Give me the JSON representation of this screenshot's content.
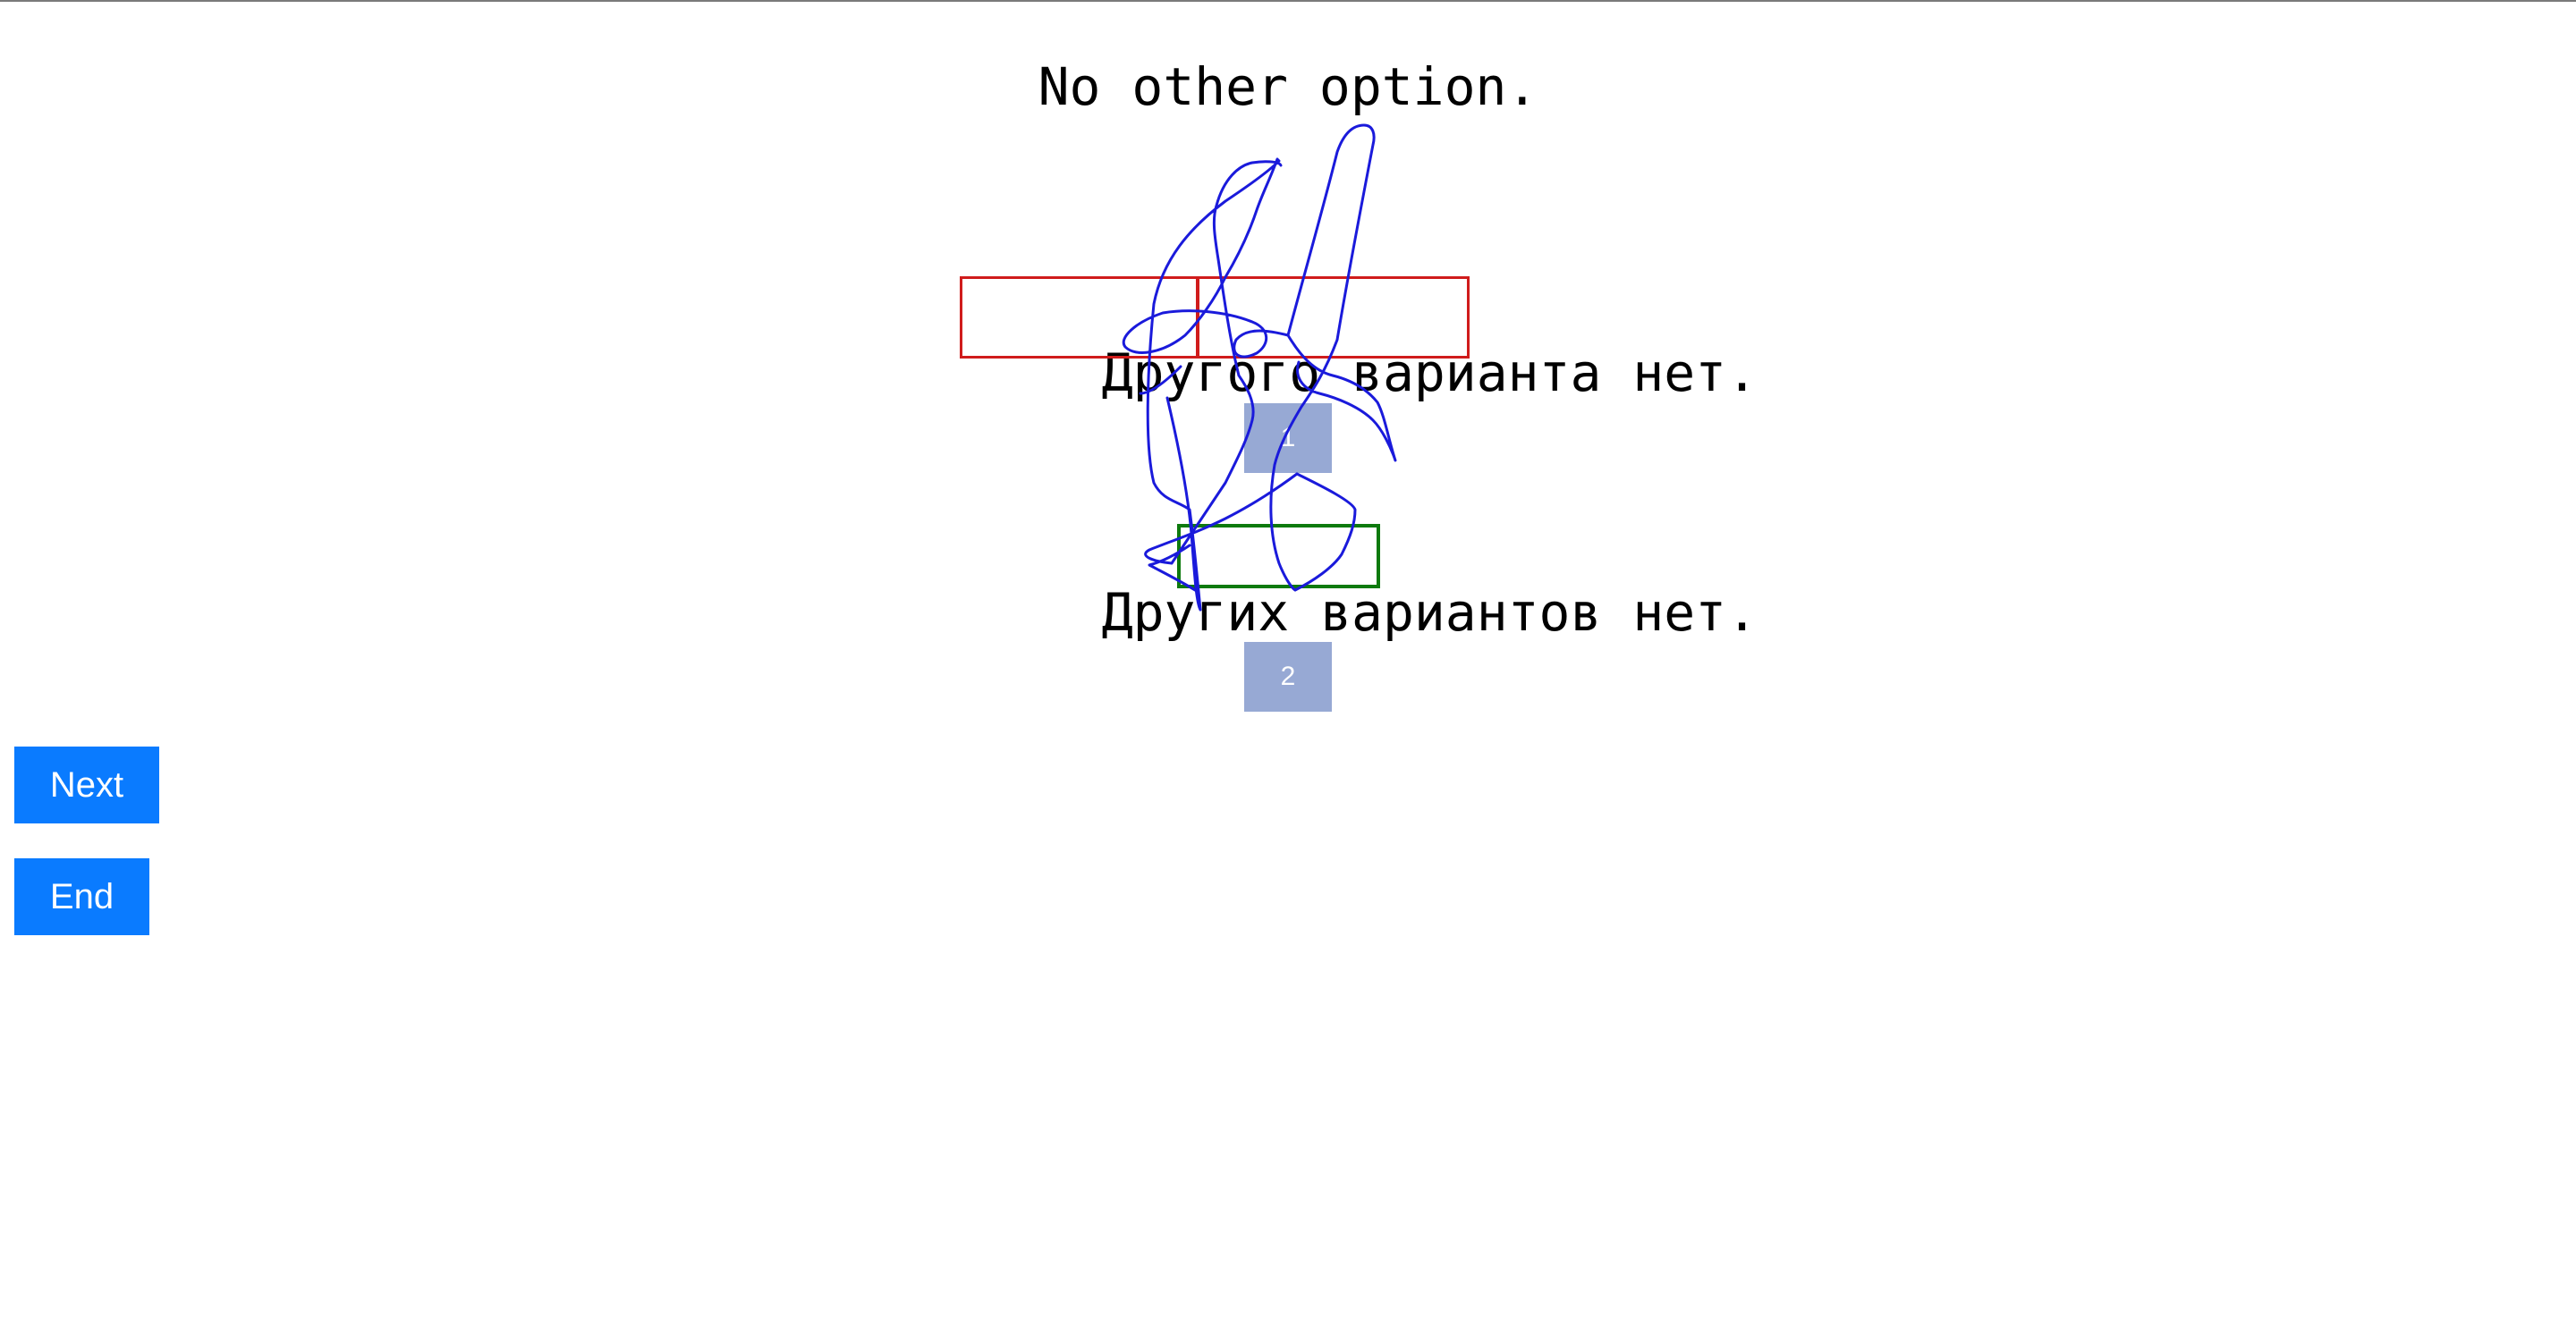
{
  "source": {
    "text": "No other option."
  },
  "hypotheses": [
    {
      "number": "1",
      "words": [
        "Другого",
        "варианта",
        "нет."
      ]
    },
    {
      "number": "2",
      "words": [
        "Других",
        "вариантов",
        "нет."
      ]
    }
  ],
  "buttons": {
    "next_label": "Next",
    "end_label": "End"
  },
  "colors": {
    "button_bg": "#0a7bff",
    "badge_bg": "#97a9d4",
    "error_box": "#d01c1c",
    "match_box": "#0e7a0e",
    "pen_stroke": "#1a1adb"
  }
}
